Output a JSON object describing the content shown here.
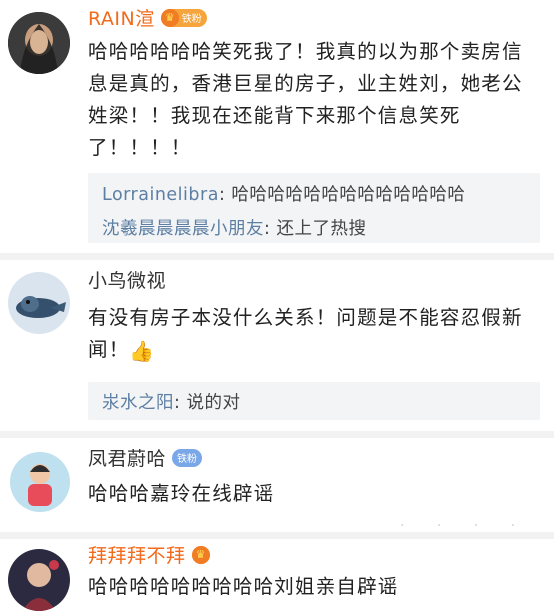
{
  "comments": [
    {
      "username": "RAIN渲",
      "badge": "铁粉",
      "text": "哈哈哈哈哈哈笑死我了！我真的以为那个卖房信息是真的，香港巨星的房子，业主姓刘，她老公姓梁！！我现在还能背下来那个信息笑死了！！！！",
      "replies": [
        {
          "name": "Lorrainelibra",
          "sep": ":",
          "text": " 哈哈哈哈哈哈哈哈哈哈哈哈哈"
        },
        {
          "name": "沈羲晨晨晨晨小朋友",
          "sep": ":",
          "text": " 还上了热搜"
        }
      ]
    },
    {
      "username": "小鸟微视",
      "text": "有没有房子本没什么关系！问题是不能容忍假新闻！",
      "replies": [
        {
          "name": "汖水之阳",
          "sep": ":",
          "text": " 说的对"
        }
      ]
    },
    {
      "username": "凤君蔚哈",
      "badge": "铁粉",
      "text": "哈哈哈嘉玲在线辟谣"
    },
    {
      "username": "拜拜拜不拜",
      "text": "哈哈哈哈哈哈哈哈哈刘姐亲自辟谣"
    }
  ],
  "colors": {
    "vip_name": "#f26a1b",
    "reply_name": "#5d7fa3",
    "reply_bg": "#f3f4f6"
  },
  "icons": [
    "thumbs-up-icon",
    "crown-icon"
  ]
}
